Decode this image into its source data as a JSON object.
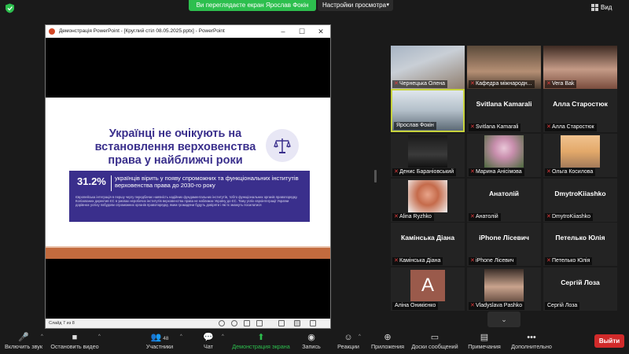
{
  "topbar": {
    "share_banner": "Ви переглядаєте екран Ярослав Фокін",
    "view_options": "Настройки просмотра",
    "view_label": "Вид"
  },
  "ppt": {
    "window_title": "Демонстрація PowerPoint - [Круглий стіл 08.05.2025.pptx] - PowerPoint",
    "slide_counter": "Слайд 7 из 8",
    "slide": {
      "title": "Українці не очікують на встановлення верховенства права у найближчі роки",
      "stat_value": "31.2%",
      "stat_text": "українців вірить у появу спроможних та функціональних інститутів верховенства права до 2030-го року",
      "stat_detail": "Європейська інтеграція в першу чергу передбачає наявність надійних фундаментальних інститутів, тобто функціональних органів правопорядку. Колізованих директив ЄС в умовах неробочих інститутів верховенства права не наближає Україну до ЄС. Тому успіх євроінтеграції України дорівнює успіху побудови спроможних органів правопорядку, яким громадяни будуть довіряти і які їх зможуть посилатися"
    }
  },
  "participants": [
    {
      "name": "Чернецька Олена",
      "muted": true,
      "type": "video"
    },
    {
      "name": "Кафедра міжнародн...",
      "muted": true,
      "type": "video"
    },
    {
      "name": "Vera Bak",
      "muted": true,
      "type": "video"
    },
    {
      "name": "Ярослав Фокін",
      "muted": false,
      "type": "video",
      "active": true
    },
    {
      "name": "Svitlana Kamarali",
      "muted": true,
      "type": "name",
      "display": "Svitlana Kamarali"
    },
    {
      "name": "Алла Старостюк",
      "muted": true,
      "type": "name",
      "display": "Алла Старостюк"
    },
    {
      "name": "Денис Бараніовський",
      "muted": true,
      "type": "video"
    },
    {
      "name": "Марина Анісімова",
      "muted": true,
      "type": "video"
    },
    {
      "name": "Ольга Косилова",
      "muted": true,
      "type": "video"
    },
    {
      "name": "Alina Ryzhko",
      "muted": true,
      "type": "video"
    },
    {
      "name": "Анатолій",
      "muted": true,
      "type": "name",
      "display": "Анатолій"
    },
    {
      "name": "DmytroKiiashko",
      "muted": true,
      "type": "name",
      "display": "DmytroKiiashko"
    },
    {
      "name": "Камінська Діана",
      "muted": true,
      "type": "name",
      "display": "Камінська Діана"
    },
    {
      "name": "iPhone Лісевич",
      "muted": true,
      "type": "name",
      "display": "iPhone Лісевич"
    },
    {
      "name": "Петелько Юлія",
      "muted": true,
      "type": "name",
      "display": "Петелько Юлія"
    },
    {
      "name": "Аліна Оникієнко",
      "muted": false,
      "type": "avatar",
      "letter": "A"
    },
    {
      "name": "Vladyslava Pashko",
      "muted": true,
      "type": "video"
    },
    {
      "name": "Сергій Лоза",
      "muted": false,
      "type": "name",
      "display": "Сергій Лоза"
    }
  ],
  "toolbar": {
    "mute": "Включить звук",
    "video": "Остановить видео",
    "participants": "Участники",
    "participants_count": "48",
    "chat": "Чат",
    "share": "Демонстрация экрана",
    "record": "Запись",
    "reactions": "Реакции",
    "apps": "Приложения",
    "whiteboards": "Доски сообщений",
    "notes": "Примечания",
    "more": "Дополнительно",
    "leave": "Выйти"
  }
}
